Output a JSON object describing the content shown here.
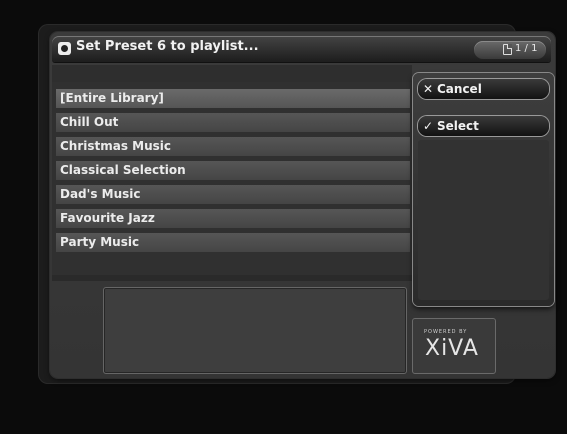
{
  "title": "Set Preset 6 to playlist...",
  "page_indicator": "1 / 1",
  "playlists": [
    "[Entire Library]",
    "Chill Out",
    "Christmas Music",
    "Classical Selection",
    "Dad's Music",
    "Favourite Jazz",
    "Party Music"
  ],
  "selected_index": 0,
  "menu": {
    "cancel_label": "Cancel",
    "select_label": "Select"
  },
  "brand": {
    "powered_by": "POWERED BY",
    "logo": "XiVA"
  },
  "colors": {
    "background": "#0b0b0b",
    "panel": "#3b3b3b",
    "text": "#ececec"
  }
}
